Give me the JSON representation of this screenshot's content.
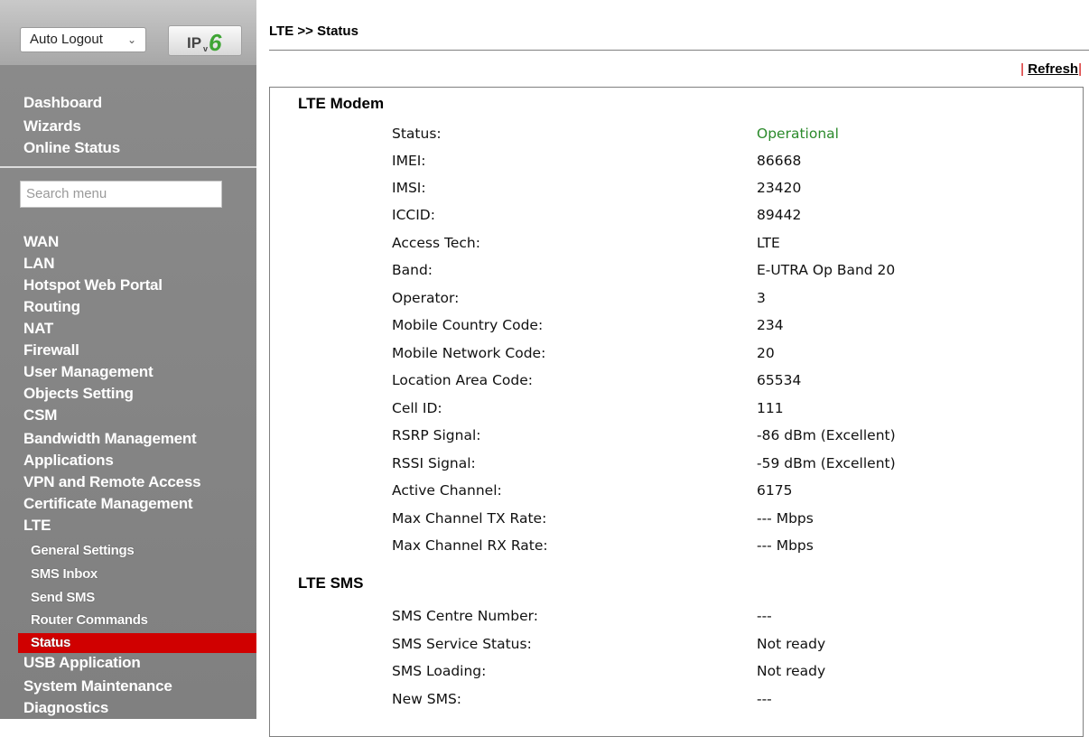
{
  "sidebar": {
    "autologout": "Auto Logout",
    "ipv6_logo": "IPv6",
    "top_items": [
      "Dashboard",
      "Wizards",
      "Online Status"
    ],
    "search_placeholder": "Search menu",
    "items": [
      "WAN",
      "LAN",
      "Hotspot Web Portal",
      "Routing",
      "NAT",
      "Firewall",
      "User Management",
      "Objects Setting",
      "CSM",
      "Bandwidth Management",
      "Applications",
      "VPN and Remote Access",
      "Certificate Management",
      "LTE"
    ],
    "lte_sub": [
      "General Settings",
      "SMS Inbox",
      "Send SMS",
      "Router Commands",
      "Status"
    ],
    "bottom_items": [
      "USB Application",
      "System Maintenance",
      "Diagnostics"
    ]
  },
  "main": {
    "title": "LTE >> Status",
    "refresh": "Refresh",
    "modem": {
      "title": "LTE Modem",
      "rows": [
        {
          "label": "Status:",
          "value": "Operational"
        },
        {
          "label": "IMEI:",
          "value": "86668"
        },
        {
          "label": "IMSI:",
          "value": "23420"
        },
        {
          "label": "ICCID:",
          "value": "89442"
        },
        {
          "label": "Access Tech:",
          "value": "LTE"
        },
        {
          "label": "Band:",
          "value": "E-UTRA Op Band 20"
        },
        {
          "label": "Operator:",
          "value": "3"
        },
        {
          "label": "Mobile Country Code:",
          "value": "234"
        },
        {
          "label": "Mobile Network Code:",
          "value": "20"
        },
        {
          "label": "Location Area Code:",
          "value": "65534"
        },
        {
          "label": "Cell ID:",
          "value": "111"
        },
        {
          "label": "RSRP Signal:",
          "value": "-86 dBm (Excellent)"
        },
        {
          "label": "RSSI Signal:",
          "value": "-59 dBm (Excellent)"
        },
        {
          "label": "Active Channel:",
          "value": "6175"
        },
        {
          "label": "Max Channel TX Rate:",
          "value": "--- Mbps"
        },
        {
          "label": "Max Channel RX Rate:",
          "value": "--- Mbps"
        }
      ]
    },
    "sms": {
      "title": "LTE SMS",
      "rows": [
        {
          "label": "SMS Centre Number:",
          "value": "---"
        },
        {
          "label": "SMS Service Status:",
          "value": "Not ready"
        },
        {
          "label": "SMS Loading:",
          "value": "Not ready"
        },
        {
          "label": "New SMS:",
          "value": "---"
        }
      ]
    }
  },
  "colors": {
    "status_ok": "#2b8a2b",
    "active_menu": "#d00000"
  }
}
